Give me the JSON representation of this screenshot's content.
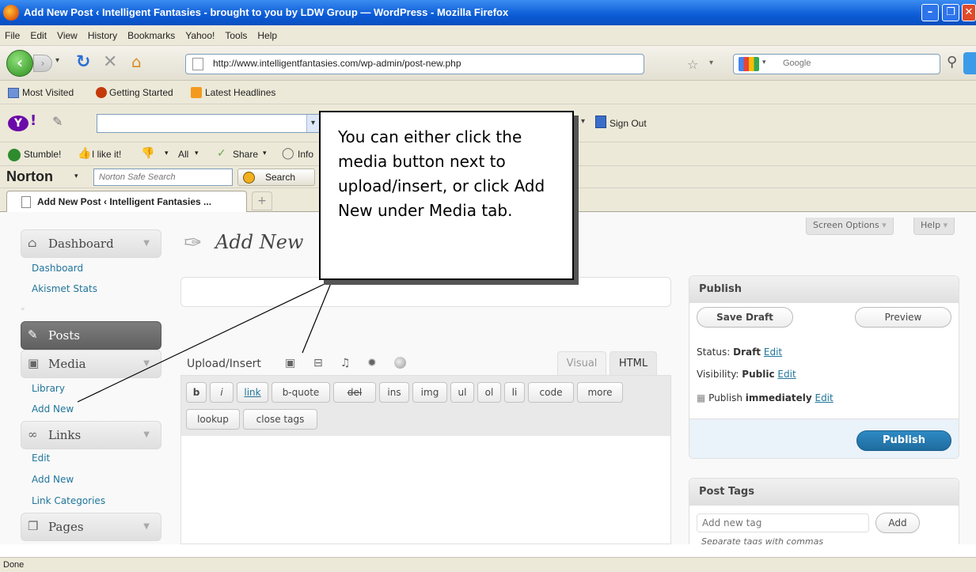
{
  "window": {
    "title": "Add New Post ‹ Intelligent Fantasies - brought to you by LDW Group — WordPress - Mozilla Firefox"
  },
  "menu": [
    "File",
    "Edit",
    "View",
    "History",
    "Bookmarks",
    "Yahoo!",
    "Tools",
    "Help"
  ],
  "nav": {
    "url": "http://www.intelligentfantasies.com/wp-admin/post-new.php",
    "search_placeholder": "Google"
  },
  "bookmarks": [
    "Most Visited",
    "Getting Started",
    "Latest Headlines"
  ],
  "yahoo_toolbar": {
    "sign_out": "Sign Out"
  },
  "stumble_toolbar": {
    "stumble": "Stumble!",
    "like": "I like it!",
    "all": "All",
    "share": "Share",
    "info": "Info"
  },
  "norton": {
    "brand": "Norton",
    "search_placeholder": "Norton Safe Search",
    "search_button": "Search"
  },
  "tab": {
    "label": "Add New Post ‹ Intelligent Fantasies ...",
    "new_tab": "+"
  },
  "wp": {
    "screen_options": "Screen Options",
    "help": "Help",
    "page_title": "Add New",
    "sidebar": {
      "dashboard": "Dashboard",
      "dashboard_items": [
        "Dashboard",
        "Akismet Stats"
      ],
      "posts": "Posts",
      "media": "Media",
      "media_items": [
        "Library",
        "Add New"
      ],
      "links": "Links",
      "links_items": [
        "Edit",
        "Add New",
        "Link Categories"
      ],
      "pages": "Pages"
    },
    "upload_insert": "Upload/Insert",
    "editor_tabs": {
      "visual": "Visual",
      "html": "HTML"
    },
    "quicktags": [
      "b",
      "i",
      "link",
      "b-quote",
      "del",
      "ins",
      "img",
      "ul",
      "ol",
      "li",
      "code",
      "more",
      "lookup",
      "close tags"
    ],
    "publish": {
      "title": "Publish",
      "save_draft": "Save Draft",
      "preview": "Preview",
      "status_label": "Status:",
      "status_value": "Draft",
      "visibility_label": "Visibility:",
      "visibility_value": "Public",
      "publish_label": "Publish",
      "publish_value": "immediately",
      "edit": "Edit",
      "publish_button": "Publish"
    },
    "post_tags": {
      "title": "Post Tags",
      "placeholder": "Add new tag",
      "add": "Add",
      "hint": "Separate tags with commas"
    }
  },
  "status": "Done",
  "callout": {
    "text": "You can either click the media button next to upload/insert, or click Add New under Media tab."
  },
  "colors": {
    "titlebar": "#0b5bd6",
    "wp_link": "#21759b",
    "publish_button": "#21759b"
  }
}
